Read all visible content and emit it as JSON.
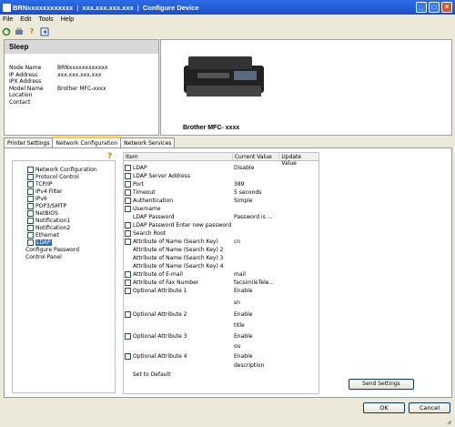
{
  "window": {
    "device_name": "BRNxxxxxxxxxxxx",
    "ip": "xxx.xxx.xxx.xxx",
    "app_title": "Configure Device",
    "separator": "|"
  },
  "menu": [
    "File",
    "Edit",
    "Tools",
    "Help"
  ],
  "toolbar": [
    "refresh-icon",
    "print-settings-icon",
    "help-icon",
    "export-icon"
  ],
  "status": {
    "state": "Sleep",
    "fields": [
      {
        "label": "Node Name",
        "value": "BRNxxxxxxxxxxxx"
      },
      {
        "label": "IP Address",
        "value": "xxx.xxx.xxx.xxx"
      },
      {
        "label": "IPX Address",
        "value": ""
      },
      {
        "label": "Model Name",
        "value": "Brother MFC-xxxx"
      },
      {
        "label": "Location",
        "value": ""
      },
      {
        "label": "Contact",
        "value": ""
      }
    ]
  },
  "printer": {
    "caption": "Brother MFC- xxxx"
  },
  "tabs": [
    "Printer Settings",
    "Network Configuration",
    "Network Services"
  ],
  "tree": {
    "items": [
      {
        "label": "Network Configuration",
        "checkbox": true
      },
      {
        "label": "Protocol Control",
        "checkbox": true
      },
      {
        "label": "TCP/IP",
        "checkbox": true
      },
      {
        "label": "IPv4 Filter",
        "checkbox": true
      },
      {
        "label": "IPv6",
        "checkbox": true
      },
      {
        "label": "POP3/SMTP",
        "checkbox": true
      },
      {
        "label": "NetBIOS",
        "checkbox": true
      },
      {
        "label": "Notification1",
        "checkbox": true
      },
      {
        "label": "Notification2",
        "checkbox": true
      },
      {
        "label": "Ethernet",
        "checkbox": true
      },
      {
        "label": "LDAP",
        "checkbox": true,
        "selected": true
      },
      {
        "label": "Configure Password",
        "checkbox": false
      },
      {
        "label": "Control Panel",
        "checkbox": false
      }
    ]
  },
  "list": {
    "headers": [
      "Item",
      "Current Value",
      "Update Value"
    ],
    "rows": [
      {
        "label": "LDAP",
        "value": "Disable",
        "checkbox": true
      },
      {
        "label": "LDAP Server Address",
        "value": "",
        "checkbox": true
      },
      {
        "label": "Port",
        "value": "389",
        "checkbox": true
      },
      {
        "label": "Timeout",
        "value": "5 seconds",
        "checkbox": true
      },
      {
        "label": "Authentication",
        "value": "Simple",
        "checkbox": true
      },
      {
        "label": "Username",
        "value": "",
        "checkbox": true
      },
      {
        "label": "LDAP Password",
        "value": "Password is ...",
        "checkbox": false
      },
      {
        "label": "LDAP Password Enter new password",
        "value": "",
        "checkbox": true
      },
      {
        "label": "Search Root",
        "value": "",
        "checkbox": true
      },
      {
        "label": "Attribute of Name (Search Key)",
        "value": "cn",
        "checkbox": true
      },
      {
        "label": "Attribute of Name (Search Key) 2",
        "value": "",
        "checkbox": false
      },
      {
        "label": "Attribute of Name (Search Key) 3",
        "value": "",
        "checkbox": false
      },
      {
        "label": "Attribute of Name (Search Key) 4",
        "value": "",
        "checkbox": false
      },
      {
        "label": "Attribute of E-mail",
        "value": "mail",
        "checkbox": true
      },
      {
        "label": "Attribute of Fax Number",
        "value": "facsimileTele...",
        "checkbox": true
      },
      {
        "label": "Optional Attribute 1",
        "value": "Enable",
        "checkbox": true
      },
      {
        "label": "",
        "value": "sn",
        "checkbox": false
      },
      {
        "label": "Optional Attribute 2",
        "value": "Enable",
        "checkbox": true
      },
      {
        "label": "",
        "value": "title",
        "checkbox": false
      },
      {
        "label": "Optional Attribute 3",
        "value": "Enable",
        "checkbox": true
      },
      {
        "label": "",
        "value": "ou",
        "checkbox": false
      },
      {
        "label": "Optional Attribute 4",
        "value": "Enable",
        "checkbox": true
      },
      {
        "label": "",
        "value": "description",
        "checkbox": false
      },
      {
        "label": "Set to Default",
        "value": "",
        "checkbox": false
      }
    ]
  },
  "buttons": {
    "send": "Send Settings",
    "ok": "OK",
    "cancel": "Cancel"
  }
}
